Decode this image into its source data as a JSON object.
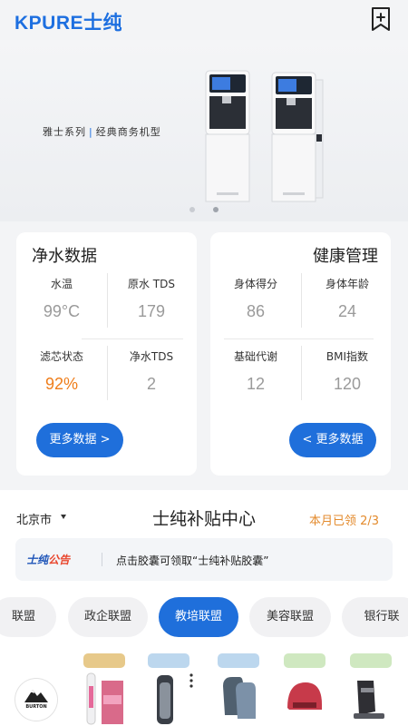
{
  "header": {
    "logo": "KPURE士纯",
    "bookmark_icon": "bookmark-plus-icon"
  },
  "banner": {
    "series": "雅士系列",
    "tagline": "经典商务机型",
    "active_slide": 1,
    "slide_count": 2
  },
  "purify": {
    "title": "净水数据",
    "metrics": [
      {
        "label": "水温",
        "value": "99°C"
      },
      {
        "label": "原水 TDS",
        "value": "179"
      },
      {
        "label": "滤芯状态",
        "value": "92%"
      },
      {
        "label": "净水TDS",
        "value": "2"
      }
    ],
    "more": "更多数据 >"
  },
  "health": {
    "title": "健康管理",
    "metrics": [
      {
        "label": "身体得分",
        "value": "86"
      },
      {
        "label": "身体年龄",
        "value": "24"
      },
      {
        "label": "基础代谢",
        "value": "12"
      },
      {
        "label": "BMI指数",
        "value": "120"
      }
    ],
    "more": "< 更多数据"
  },
  "subsidy": {
    "city": "北京市",
    "title": "士纯补贴中心",
    "claimed": "本月已领 2/3",
    "notice_brand_a": "士纯",
    "notice_brand_b": "公告",
    "notice_text": "点击胶囊可领取“士纯补贴胶囊”",
    "tabs": [
      "联盟",
      "政企联盟",
      "教培联盟",
      "美容联盟",
      "银行联"
    ],
    "active_tab": 2,
    "brand": "BURTON"
  },
  "colors": {
    "accent": "#1f6fdb",
    "orange": "#ef7d1a",
    "claimed": "#e38a2c"
  }
}
